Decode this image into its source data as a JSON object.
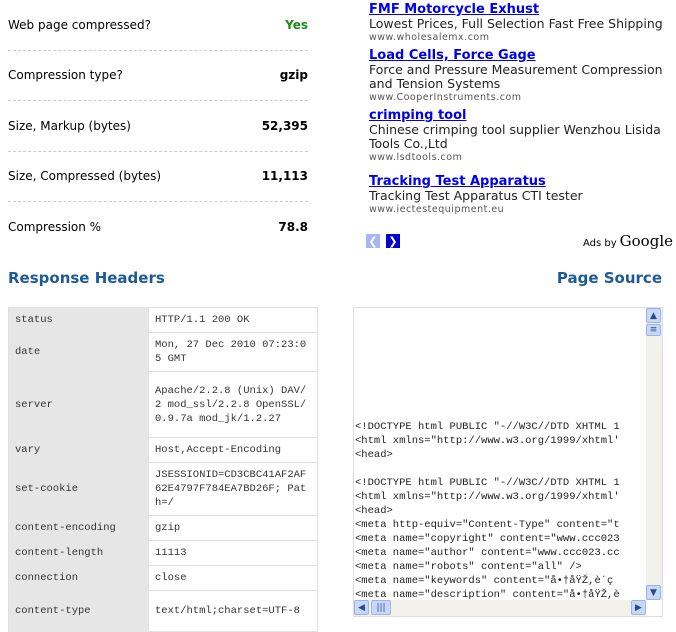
{
  "stats": [
    {
      "label": "Web page compressed?",
      "value": "Yes"
    },
    {
      "label": "Compression type?",
      "value": "gzip"
    },
    {
      "label": "Size, Markup (bytes)",
      "value": "52,395"
    },
    {
      "label": "Size, Compressed (bytes)",
      "value": "11,113"
    },
    {
      "label": "Compression %",
      "value": "78.8"
    }
  ],
  "ads": [
    {
      "title": "FMF Motorcycle Exhust",
      "desc": "Lowest Prices, Full Selection Fast Free Shipping",
      "url": "www.wholesalemx.com"
    },
    {
      "title": "Load Cells, Force Gage",
      "desc": "Force and Pressure Measurement Compression and Tension Systems",
      "url": "www.CooperInstruments.com"
    },
    {
      "title": "crimping tool",
      "desc": "Chinese crimping tool supplier Wenzhou Lisida Tools Co.,Ltd",
      "url": "www.lsdtools.com"
    },
    {
      "title": "Tracking Test Apparatus",
      "desc": "Tracking Test Apparatus CTI tester",
      "url": "www.iectestequipment.eu"
    }
  ],
  "ads_by": {
    "label": "Ads by",
    "brand": "Google"
  },
  "headings": {
    "response_headers": "Response Headers",
    "page_source": "Page Source"
  },
  "headers": [
    {
      "key": "status",
      "value": "HTTP/1.1 200 OK"
    },
    {
      "key": "date",
      "value": "Mon, 27 Dec 2010 07:23:05 GMT"
    },
    {
      "key": "server",
      "value": "Apache/2.2.8 (Unix) DAV/2 mod_ssl/2.2.8 OpenSSL/0.9.7a mod_jk/1.2.27"
    },
    {
      "key": "vary",
      "value": "Host,Accept-Encoding"
    },
    {
      "key": "set-cookie",
      "value": "JSESSIONID=CD3CBC41AF2AF62E4797F784EA7BD26F; Path=/"
    },
    {
      "key": "content-encoding",
      "value": "gzip"
    },
    {
      "key": "content-length",
      "value": "11113"
    },
    {
      "key": "connection",
      "value": "close"
    },
    {
      "key": "content-type",
      "value": "text/html;charset=UTF-8"
    }
  ],
  "source": "<!DOCTYPE html PUBLIC \"-//W3C//DTD XHTML 1\n<html xmlns=\"http://www.w3.org/1999/xhtml'\n<head>\n\n<!DOCTYPE html PUBLIC \"-//W3C//DTD XHTML 1\n<html xmlns=\"http://www.w3.org/1999/xhtml'\n<head>\n<meta http-equiv=\"Content-Type\" content=\"t\n<meta name=\"copyright\" content=\"www.ccc023\n<meta name=\"author\" content=\"www.ccc023.cc\n<meta name=\"robots\" content=\"all\" />\n<meta name=\"keywords\" content=\"å•†åŸŽ,è´ç\n<meta name=\"description\" content=\"å•†åŸŽ,è"
}
